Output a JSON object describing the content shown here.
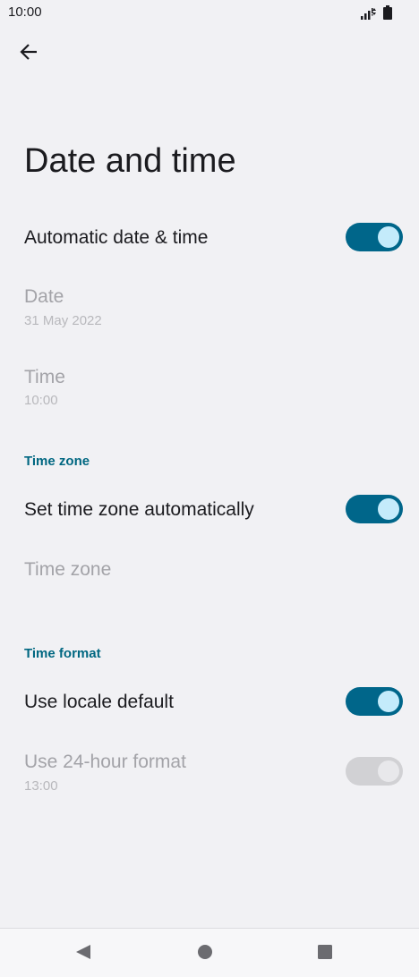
{
  "status_bar": {
    "time": "10:00",
    "icons": [
      "signal-icon",
      "battery-icon"
    ]
  },
  "header": {
    "back_icon": "arrow-left-icon",
    "title": "Date and time"
  },
  "settings": {
    "automatic_date_time": {
      "title": "Automatic date & time",
      "enabled": true
    },
    "date": {
      "title": "Date",
      "summary": "31 May 2022"
    },
    "time": {
      "title": "Time",
      "summary": "10:00"
    },
    "time_zone_section": "Time zone",
    "set_time_zone_automatically": {
      "title": "Set time zone automatically",
      "enabled": true
    },
    "time_zone": {
      "title": "Time zone"
    },
    "time_format_section": "Time format",
    "use_locale_default": {
      "title": "Use locale default",
      "enabled": true
    },
    "use_24_hour_format": {
      "title": "Use 24-hour format",
      "summary": "13:00",
      "enabled": true,
      "disabled": true
    }
  },
  "nav_bar": {
    "buttons": [
      "back-triangle-icon",
      "home-circle-icon",
      "recents-square-icon"
    ]
  },
  "colors": {
    "background": "#f1f1f4",
    "accent": "#006781",
    "switch_on": "#00668a",
    "switch_thumb": "#c4ebfb",
    "disabled_text": "#a3a3a8"
  }
}
